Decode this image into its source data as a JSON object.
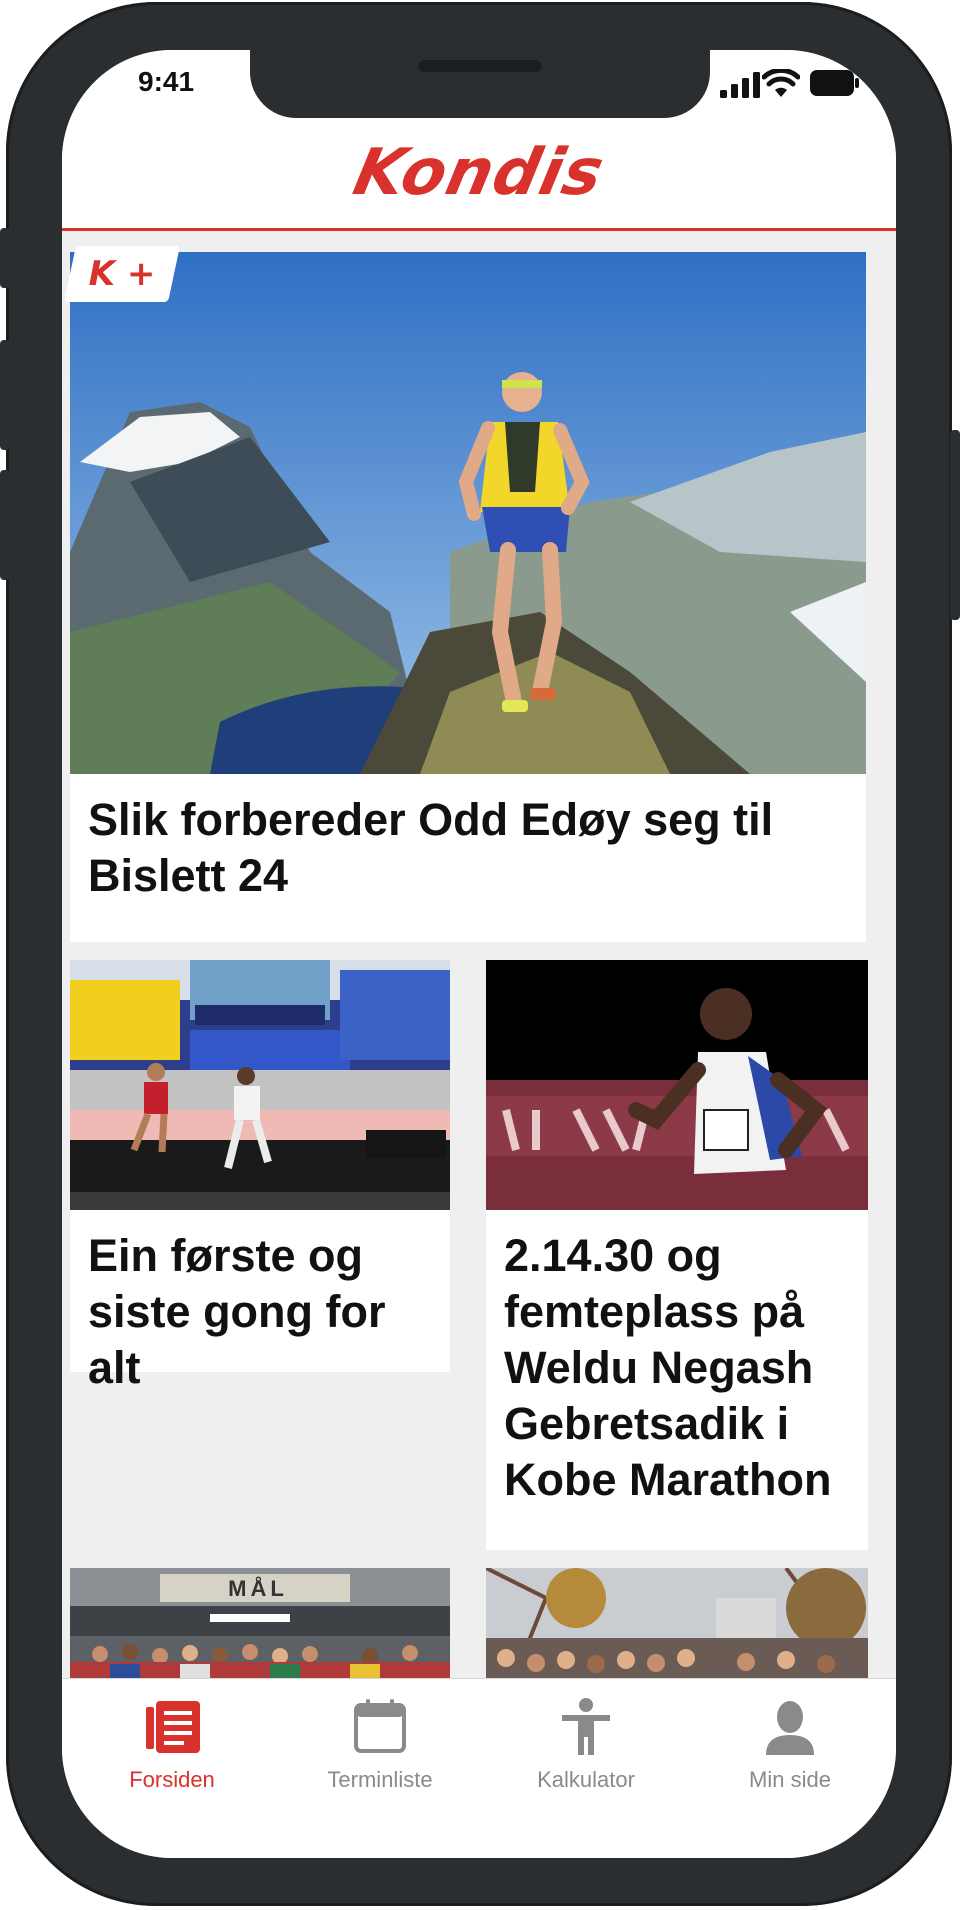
{
  "status_bar": {
    "time": "9:41"
  },
  "header": {
    "logo_text": "Kondis"
  },
  "feed": {
    "featured": {
      "badge": "K +",
      "title": "Slik forbereder Odd Edøy seg til Bislett 24"
    },
    "articles": [
      {
        "title": "Ein første og siste gong for alt"
      },
      {
        "title": "2.14.30 og femteplass på Weldu Negash Gebretsadik i Kobe Marathon"
      },
      {
        "sign_text": "MÅL"
      }
    ]
  },
  "tab_bar": {
    "active": "Forsiden",
    "accent_color": "#d9312b",
    "inactive_color": "#8a8a8a",
    "items": [
      {
        "label": "Forsiden",
        "icon": "article-icon"
      },
      {
        "label": "Terminliste",
        "icon": "calendar-icon"
      },
      {
        "label": "Kalkulator",
        "icon": "person-icon"
      },
      {
        "label": "Min side",
        "icon": "profile-icon"
      }
    ]
  }
}
